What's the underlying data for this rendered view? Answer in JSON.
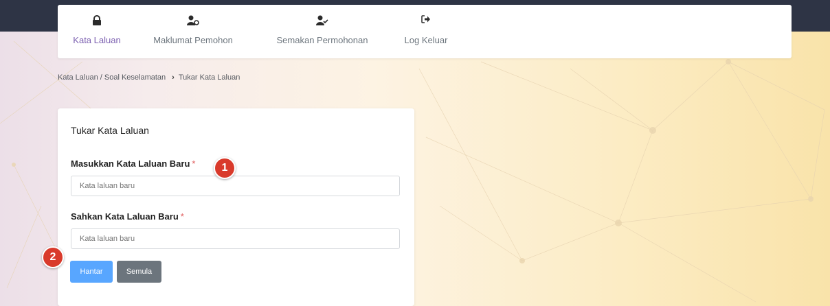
{
  "nav": {
    "items": [
      {
        "label": "Kata Laluan",
        "icon": "lock-icon",
        "active": true
      },
      {
        "label": "Maklumat Pemohon",
        "icon": "user-info-icon",
        "active": false
      },
      {
        "label": "Semakan Permohonan",
        "icon": "user-check-icon",
        "active": false
      },
      {
        "label": "Log Keluar",
        "icon": "sign-out-icon",
        "active": false
      }
    ]
  },
  "breadcrumb": {
    "parent": "Kata Laluan / Soal Keselamatan",
    "current": "Tukar Kata Laluan"
  },
  "form": {
    "title": "Tukar Kata Laluan",
    "new_password": {
      "label": "Masukkan Kata Laluan Baru",
      "required_mark": "*",
      "placeholder": "Kata laluan baru",
      "value": ""
    },
    "confirm_password": {
      "label": "Sahkan Kata Laluan Baru",
      "required_mark": "*",
      "placeholder": "Kata laluan baru",
      "value": ""
    },
    "submit_label": "Hantar",
    "reset_label": "Semula"
  },
  "annotations": [
    "1",
    "2"
  ],
  "colors": {
    "topbar": "#2e3445",
    "active_nav": "#7b5fb0",
    "primary_button": "#58a6ff",
    "secondary_button": "#6c757d",
    "required": "#e05a5a",
    "marker": "#d93a2b"
  }
}
